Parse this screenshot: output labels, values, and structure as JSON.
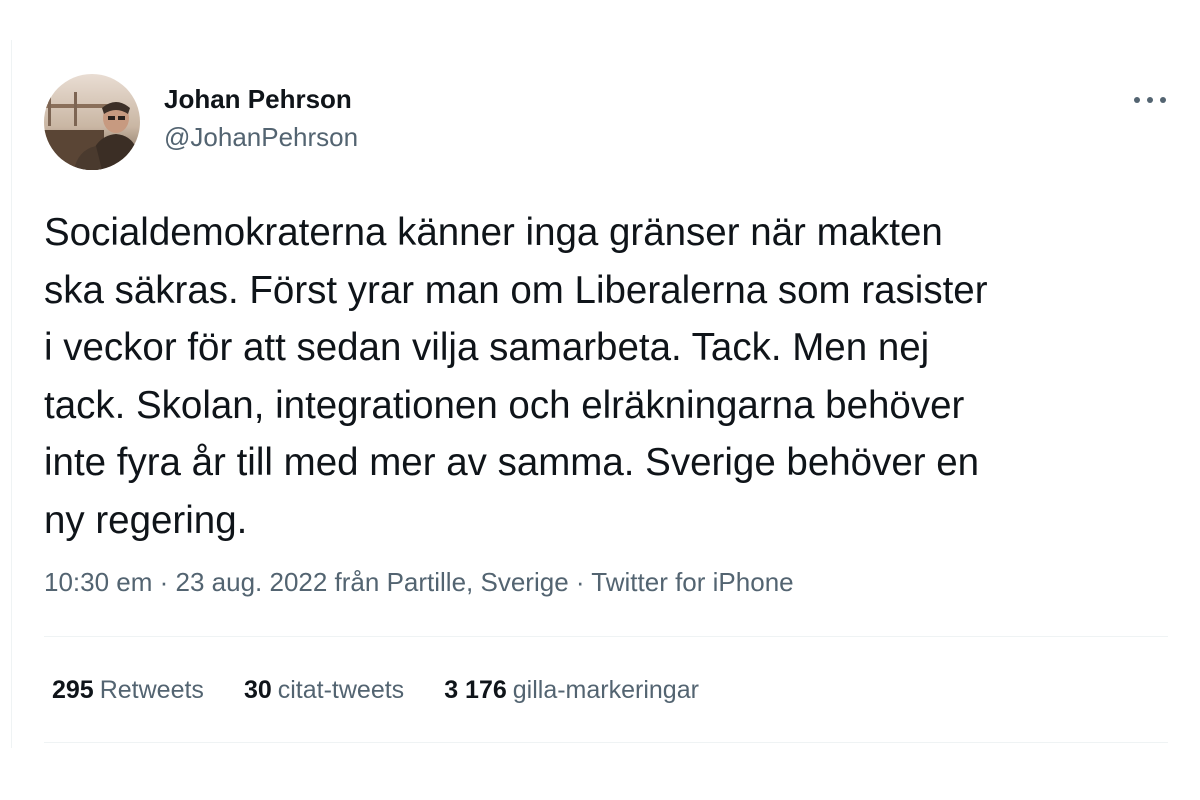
{
  "author": {
    "display_name": "Johan Pehrson",
    "handle": "@JohanPehrson",
    "avatar_icon": "profile-photo"
  },
  "tweet": {
    "text_lines": [
      "Socialdemokraterna känner inga gränser när makten",
      "ska säkras. Först yrar man om Liberalerna som rasister",
      "i veckor för att sedan vilja samarbeta. Tack. Men nej",
      "tack. Skolan, integrationen och elräkningarna behöver",
      "inte fyra år till med mer av samma. Sverige behöver en",
      "ny regering."
    ]
  },
  "meta": {
    "time": "10:30 em",
    "separator": " · ",
    "date_location": "23 aug. 2022 från Partille, Sverige",
    "source": "Twitter for iPhone"
  },
  "stats": {
    "retweets_count": "295",
    "retweets_label": "Retweets",
    "quotes_count": "30",
    "quotes_label": "citat-tweets",
    "likes_count": "3 176",
    "likes_label": "gilla-markeringar"
  },
  "colors": {
    "text_primary": "#0f1419",
    "text_secondary": "#536471",
    "divider": "#eff3f4"
  }
}
